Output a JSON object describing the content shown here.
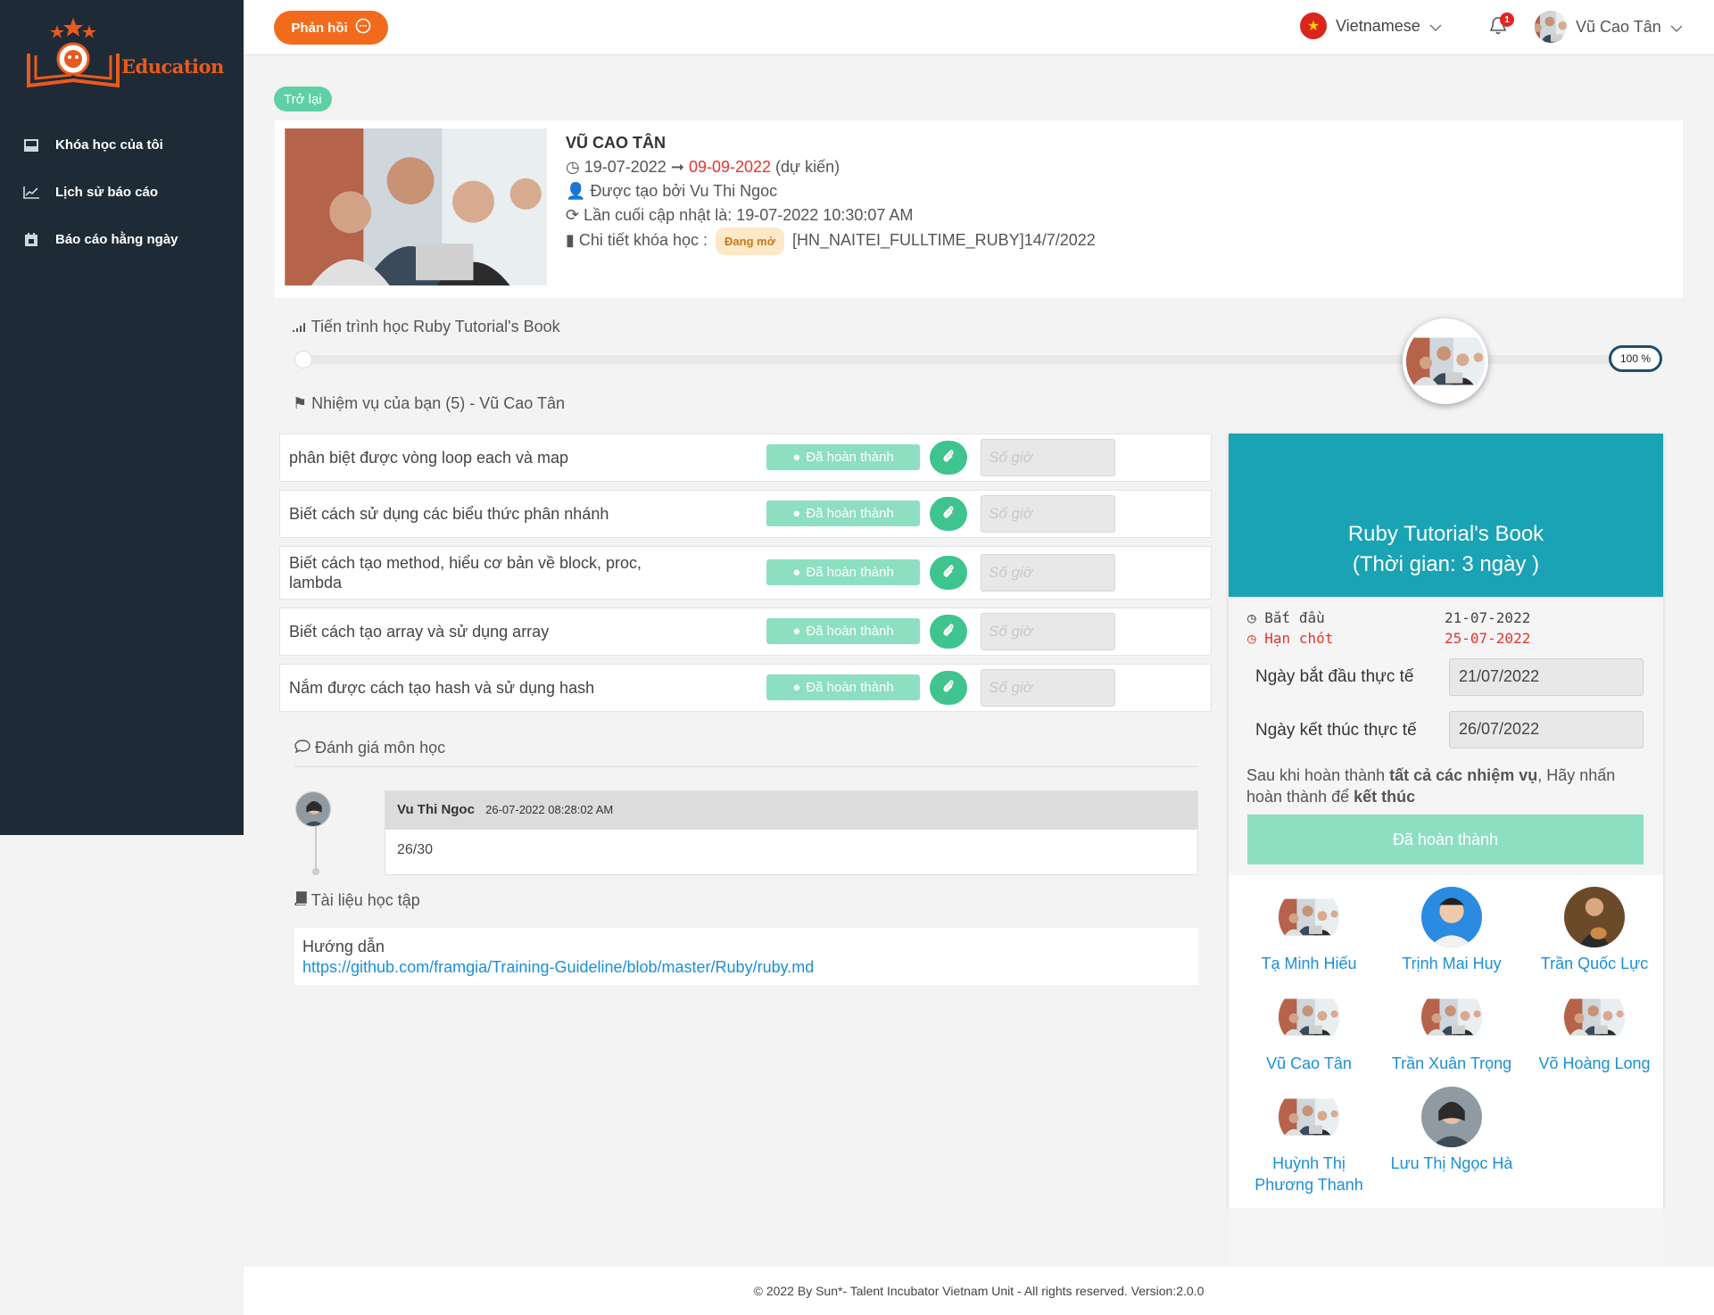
{
  "brand": {
    "name": "Education"
  },
  "sidebar": {
    "items": [
      {
        "label": "Khóa học của tôi",
        "icon": "book-icon"
      },
      {
        "label": "Lịch sử báo cáo",
        "icon": "line-chart-icon"
      },
      {
        "label": "Báo cáo hằng ngày",
        "icon": "calendar-icon"
      }
    ]
  },
  "header": {
    "feedback_label": "Phản hồi",
    "language": "Vietnamese",
    "notification_count": "1",
    "user_name": "Vũ Cao Tân"
  },
  "back_label": "Trở lại",
  "course": {
    "trainee": "VŨ CAO TÂN",
    "start_date": "19-07-2022",
    "end_date": "09-09-2022",
    "end_note": "(dự kiến)",
    "trainer_text": "Được tạo bởi Vu Thi Ngoc",
    "updated_text": "Lần cuối cập nhật là: 19-07-2022 10:30:07 AM",
    "detail_label": "Chi tiết khóa học :",
    "status_badge": "Đang mở",
    "course_code": "[HN_NAITEI_FULLTIME_RUBY]14/7/2022"
  },
  "progress": {
    "title": "Tiến trình học Ruby Tutorial's Book",
    "percent_label": "100 %",
    "value": 0.82
  },
  "tasks": {
    "title": "Nhiệm vụ của bạn (5) - Vũ Cao Tân",
    "status_label": "Đã hoàn thành",
    "hours_placeholder": "Số giờ",
    "items": [
      "phân biệt được vòng loop each và map",
      "Biết cách sử dụng các biểu thức phân nhánh",
      "Biết cách tạo method, hiểu cơ bản về block, proc, lambda",
      "Biết cách tạo array và sử dụng array",
      "Nắm được cách tạo hash và sử dụng hash"
    ]
  },
  "subject": {
    "title": "Ruby Tutorial's Book",
    "duration": "(Thời gian: 3 ngày )",
    "start_label": "Bắt đầu",
    "start_date": "21-07-2022",
    "deadline_label": "Hạn chót",
    "deadline_date": "25-07-2022",
    "actual_start_label": "Ngày bắt đầu thực tế",
    "actual_start_value": "21/07/2022",
    "actual_end_label": "Ngày kết thúc thực tế",
    "actual_end_value": "26/07/2022",
    "note_prefix": "Sau khi hoàn thành ",
    "note_bold1": "tất cả các nhiệm vụ",
    "note_mid": ", Hãy nhấn hoàn thành để ",
    "note_bold2": "kết thúc",
    "done_button": "Đã hoàn thành",
    "members": [
      "Tạ Minh Hiếu",
      "Trịnh Mai Huy",
      "Trần Quốc Lực",
      "Vũ Cao Tân",
      "Trần Xuân Trọng",
      "Võ Hoàng Long",
      "Huỳnh Thị Phương Thanh",
      "Lưu Thị Ngọc Hà"
    ]
  },
  "review": {
    "title": "Đánh giá môn học",
    "author": "Vu Thi Ngoc",
    "time": "26-07-2022 08:28:02 AM",
    "content": "26/30"
  },
  "docs": {
    "title": "Tài liệu học tập",
    "label": "Hướng dẫn",
    "link": "https://github.com/framgia/Training-Guideline/blob/master/Ruby/ruby.md"
  },
  "footer": {
    "text": "2022 By Sun*- Talent Incubator Vietnam Unit - All rights reserved. Version:2.0.0"
  },
  "colors": {
    "sidebar": "#1f2a37",
    "brand": "#f26b1d",
    "accent": "#1aa3b4",
    "success": "#8ddfc1",
    "link": "#1a8fd8"
  }
}
